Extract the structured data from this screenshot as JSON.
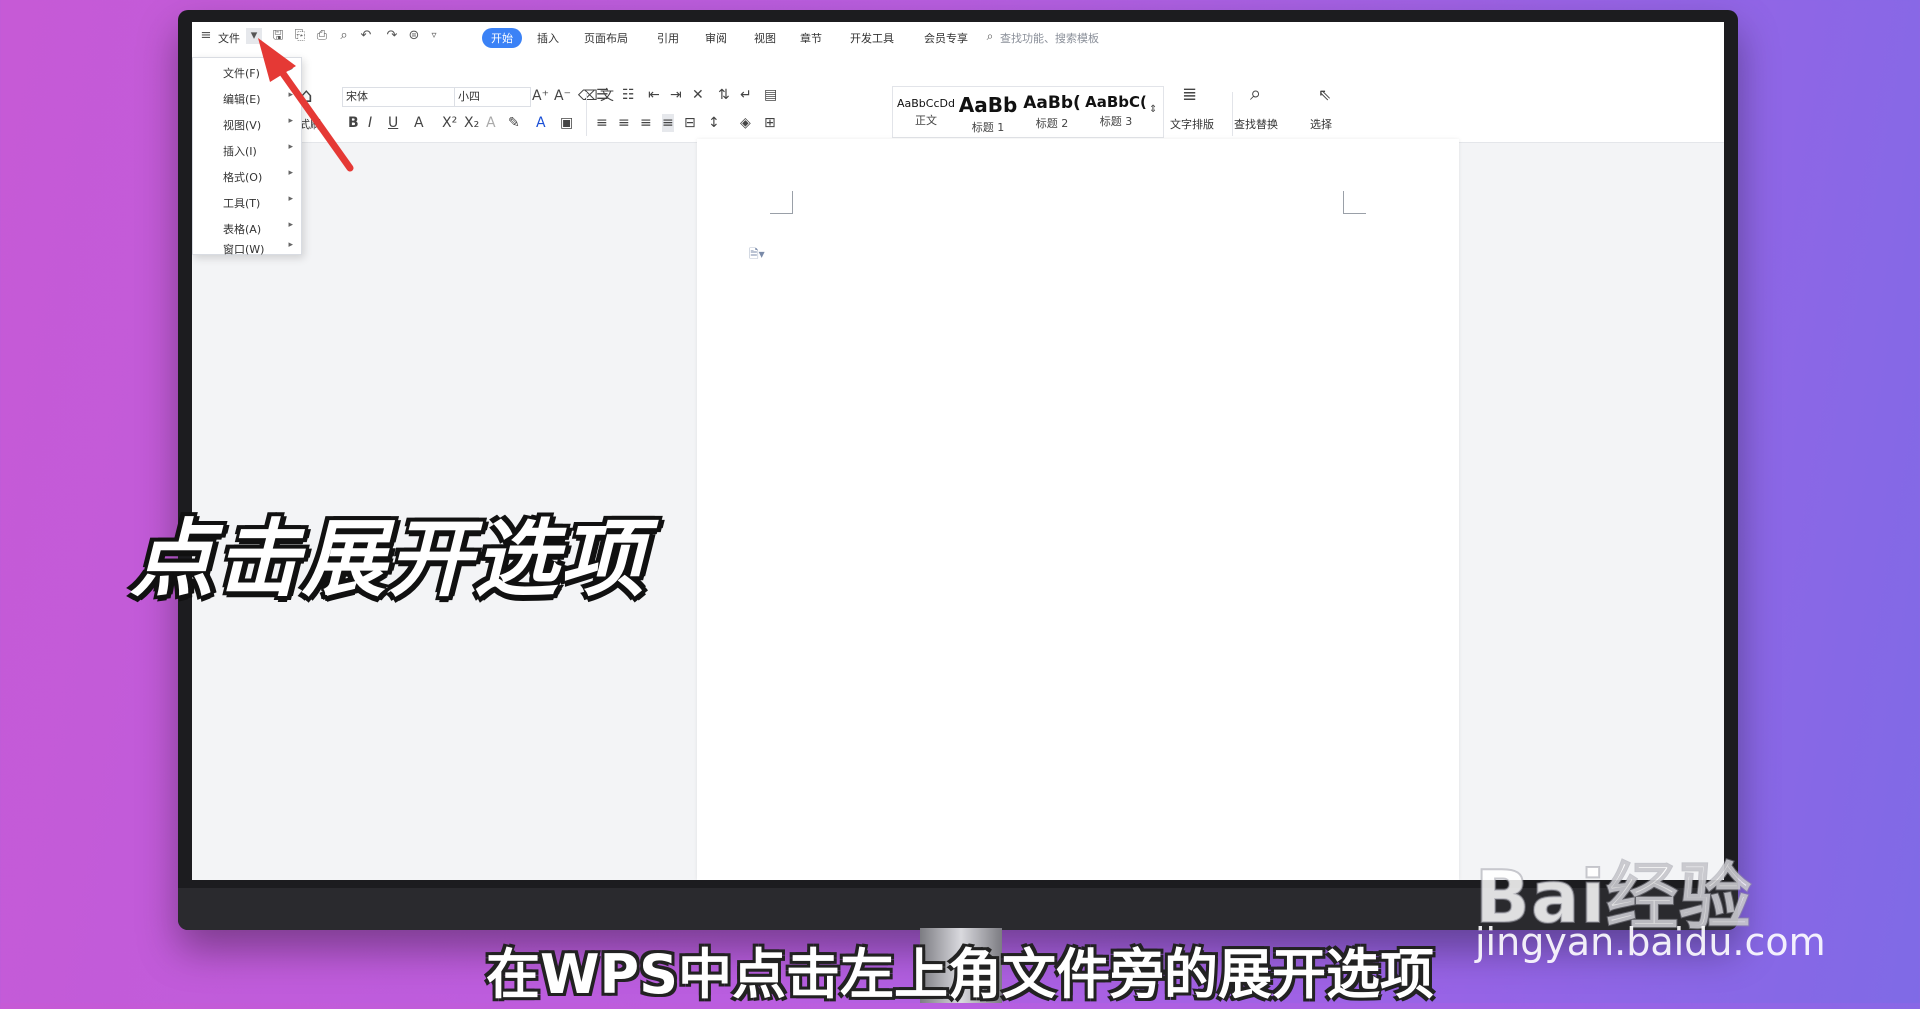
{
  "colors": {
    "accent": "#3b82f6",
    "arrow": "#e53935",
    "background": "#c65ad6"
  },
  "topbar": {
    "menu_label": "文件",
    "tabs": [
      "开始",
      "插入",
      "页面布局",
      "引用",
      "审阅",
      "视图",
      "章节",
      "开发工具",
      "会员专享"
    ],
    "active_tab": "开始",
    "search_placeholder": "查找功能、搜索模板"
  },
  "ribbon": {
    "format_painter_label": "格式刷",
    "font_name": "宋体",
    "font_size": "小四",
    "styles": [
      {
        "sample": "AaBbCcDd",
        "name": "正文"
      },
      {
        "sample": "AaBb",
        "name": "标题 1"
      },
      {
        "sample": "AaBb(",
        "name": "标题 2"
      },
      {
        "sample": "AaBbC(",
        "name": "标题 3"
      }
    ],
    "text_layout_label": "文字排版",
    "find_replace_label": "查找替换",
    "select_label": "选择"
  },
  "file_menu": {
    "items": [
      "文件(F)",
      "编辑(E)",
      "视图(V)",
      "插入(I)",
      "格式(O)",
      "工具(T)",
      "表格(A)",
      "窗口(W)"
    ]
  },
  "overlay": {
    "title": "点击展开选项",
    "subtitle": "在WPS中点击左上角文件旁的展开选项"
  },
  "watermark": {
    "brand": "Bai经验",
    "url": "jingyan.baidu.com"
  }
}
